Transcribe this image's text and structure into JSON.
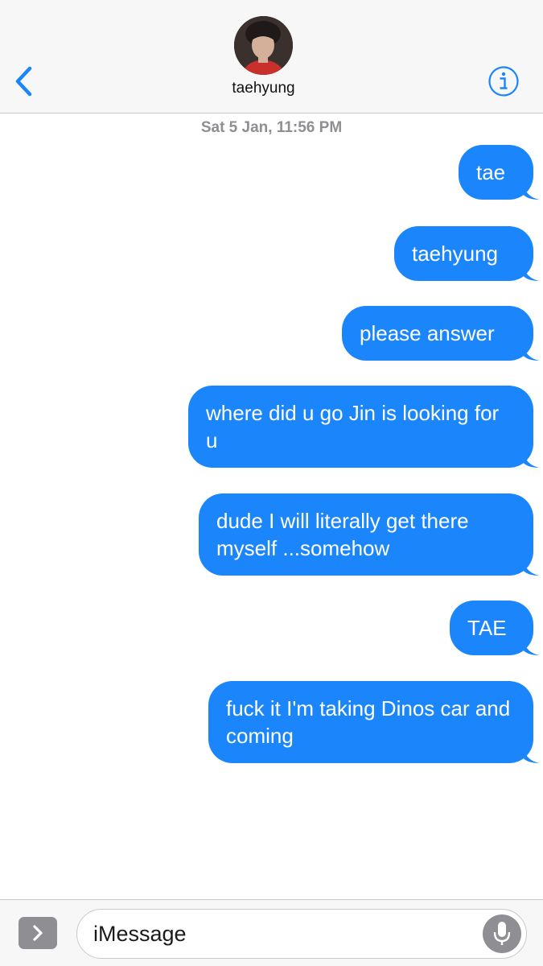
{
  "header": {
    "contact_name": "taehyung",
    "back_icon": "chevron-left-icon",
    "info_icon": "info-icon",
    "accent_color": "#1b86fb"
  },
  "conversation": {
    "timestamp": "Sat 5 Jan, 11:56 PM",
    "bubble_color": "#1b86fb",
    "messages": [
      {
        "sender": "me",
        "text": "tae"
      },
      {
        "sender": "me",
        "text": "taehyung"
      },
      {
        "sender": "me",
        "text": "please answer"
      },
      {
        "sender": "me",
        "text": "where did u go Jin is looking for u"
      },
      {
        "sender": "me",
        "text": "dude I will literally get there myself ...somehow"
      },
      {
        "sender": "me",
        "text": "TAE"
      },
      {
        "sender": "me",
        "text": "fuck it I'm taking Dinos car and coming"
      }
    ]
  },
  "input_bar": {
    "placeholder": "iMessage",
    "apps_icon": "chevron-right-icon",
    "mic_icon": "microphone-icon"
  }
}
